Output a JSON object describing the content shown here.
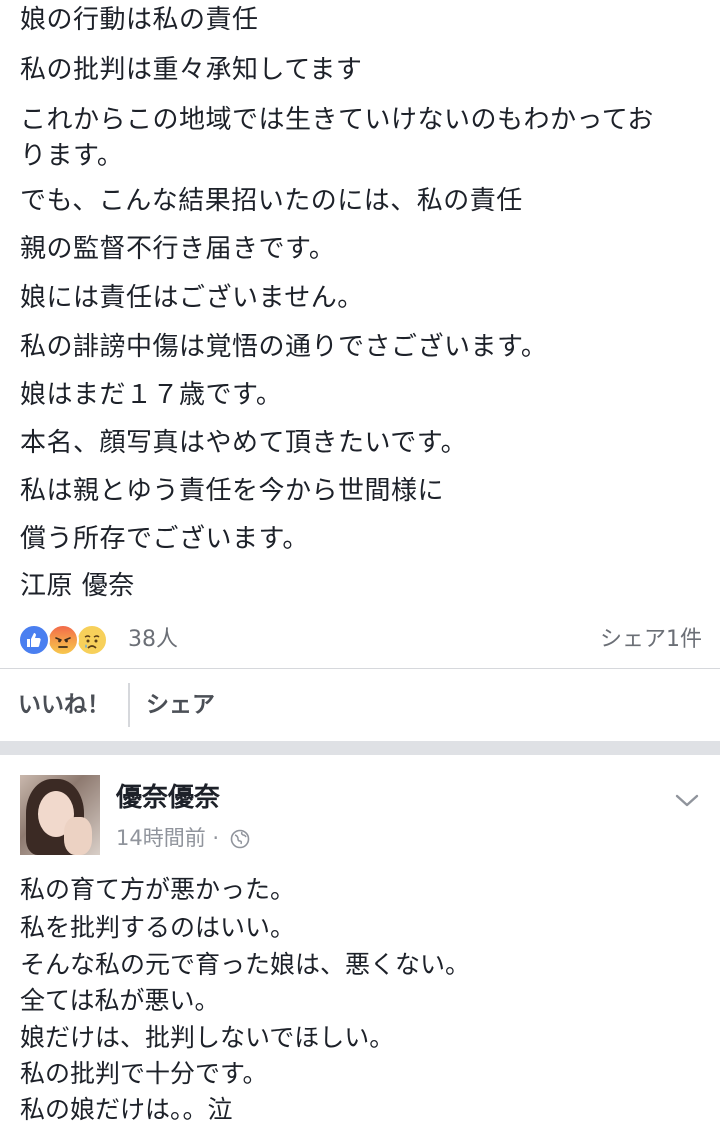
{
  "post1": {
    "lines": [
      "娘の行動は私の責任",
      "私の批判は重々承知してます",
      "これからこの地域では生きていけないのもわかってお",
      "ります。",
      "でも、こんな結果招いたのには、私の責任",
      "親の監督不行き届きです。",
      "娘には責任はございません。",
      "私の誹謗中傷は覚悟の通りでさございます。",
      "娘はまだ１７歳です。",
      "本名、顔写真はやめて頂きたいです。",
      "私は親とゆう責任を今から世間様に",
      "償う所存でございます。",
      "江原 優奈"
    ],
    "reactions": {
      "icons": [
        "like-icon",
        "angry-icon",
        "sad-icon"
      ],
      "count": "38人",
      "shares": "シェア1件"
    },
    "actions": {
      "like_label": "いいね！",
      "share_label": "シェア"
    }
  },
  "post2": {
    "author": "優奈優奈",
    "time": "14時間前 ·",
    "privacy_icon": "globe-icon",
    "menu_icon": "chevron-down-icon",
    "lines": [
      "私の育て方が悪かった。",
      "私を批判するのはいい。",
      "そんな私の元で育った娘は、悪くない。",
      "全ては私が悪い。",
      "娘だけは、批判しないでほしい。",
      "私の批判で十分です。",
      "私の娘だけは。。泣"
    ]
  },
  "colors": {
    "text": "#1d2129",
    "secondary": "#90949c",
    "like_blue": "#4a7ff0",
    "divider": "#d6d8dc",
    "gap": "#dfe1e5"
  }
}
